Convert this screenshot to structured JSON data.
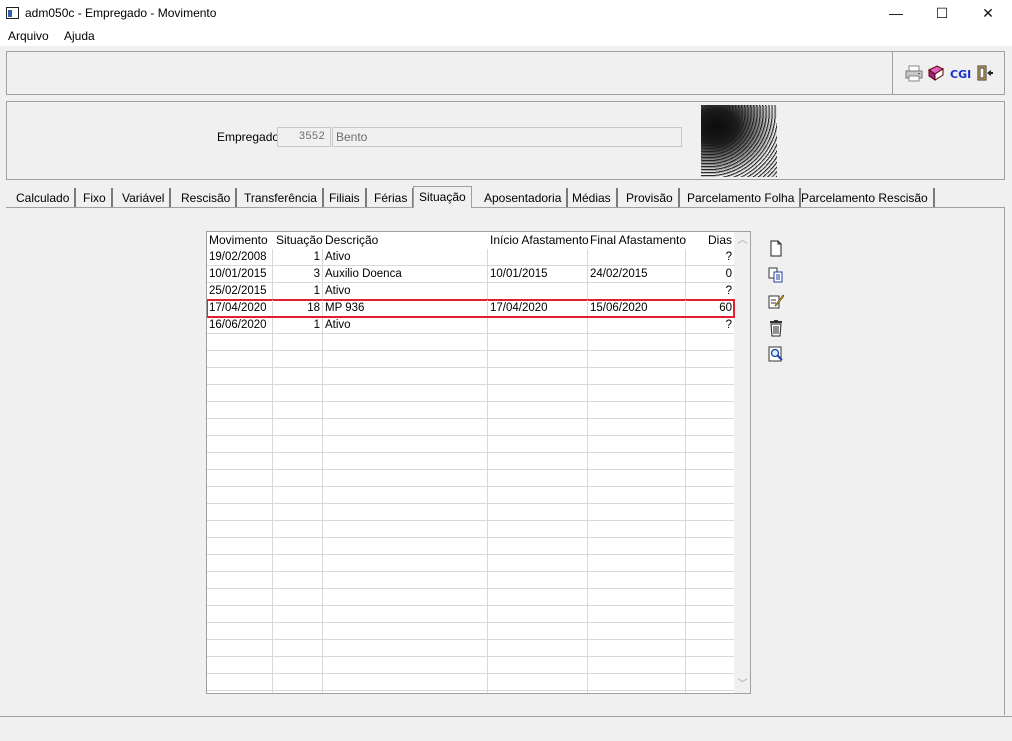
{
  "window": {
    "title": "adm050c - Empregado - Movimento",
    "minimize": "—",
    "maximize": "☐",
    "close": "✕"
  },
  "menu": [
    "Arquivo",
    "Ajuda"
  ],
  "employee": {
    "label": "Empregado:",
    "code": "3552",
    "name": "Bento"
  },
  "tabs": [
    "Calculado",
    "Fixo",
    "Variável",
    "Rescisão",
    "Transferência",
    "Filiais",
    "Férias",
    "Situação",
    "Aposentadoria",
    "Médias",
    "Provisão",
    "Parcelamento Folha",
    "Parcelamento Rescisão"
  ],
  "active_tab": "Situação",
  "grid": {
    "columns": [
      "Movimento",
      "Situação",
      "Descrição",
      "Início Afastamento",
      "Final Afastamento",
      "Dias"
    ],
    "rows": [
      [
        "19/02/2008",
        "1",
        "Ativo",
        "",
        "",
        "?"
      ],
      [
        "10/01/2015",
        "3",
        "Auxilio Doenca",
        "10/01/2015",
        "24/02/2015",
        "0"
      ],
      [
        "25/02/2015",
        "1",
        "Ativo",
        "",
        "",
        "?"
      ],
      [
        "17/04/2020",
        "18",
        "MP 936",
        "17/04/2020",
        "15/06/2020",
        "60"
      ],
      [
        "16/06/2020",
        "1",
        "Ativo",
        "",
        "",
        "?"
      ]
    ],
    "selected_row": 3
  },
  "toolbar_icons": [
    "printer-icon",
    "book-icon",
    "cgi-icon",
    "exit-door-icon"
  ],
  "toolbar_cgi_text": "CGI",
  "side_icons": [
    "new-document-icon",
    "copy-icon",
    "edit-icon",
    "delete-icon",
    "search-icon"
  ],
  "colors": {
    "selection_outline": "#e0202e",
    "background": "#f0f0f0"
  }
}
